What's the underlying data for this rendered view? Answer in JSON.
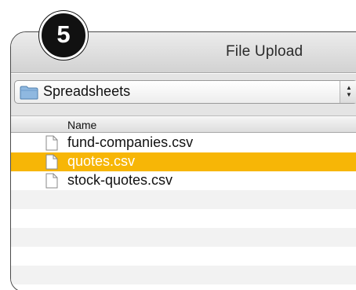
{
  "window": {
    "title": "File Upload"
  },
  "step_badge": {
    "number": "5"
  },
  "folder_popup": {
    "selected": "Spreadsheets",
    "icon": "folder-icon"
  },
  "file_list": {
    "column_header": "Name",
    "files": [
      {
        "name": "fund-companies.csv",
        "icon": "document-icon",
        "selected": false
      },
      {
        "name": "quotes.csv",
        "icon": "document-icon",
        "selected": true
      },
      {
        "name": "stock-quotes.csv",
        "icon": "document-icon",
        "selected": false
      }
    ]
  },
  "colors": {
    "selection": "#f7b606",
    "badge_background": "#111111",
    "folder_blue": "#8fb8e0"
  }
}
